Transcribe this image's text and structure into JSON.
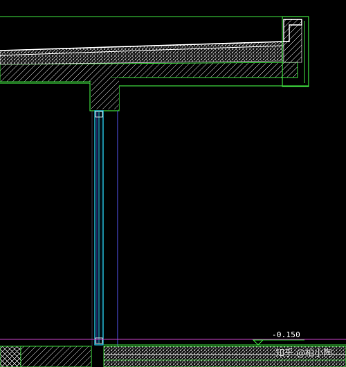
{
  "drawing": {
    "elevation_label": "-0.150",
    "watermark_text": "知乎 @柏小陶"
  },
  "colors": {
    "background": "#000000",
    "outline_green": "#3cd43c",
    "glass_cyan": "#27c4e0",
    "guide_blue": "#4f4fe0",
    "guide_magenta": "#c040c0",
    "hatch_white": "#d8d8d8"
  }
}
